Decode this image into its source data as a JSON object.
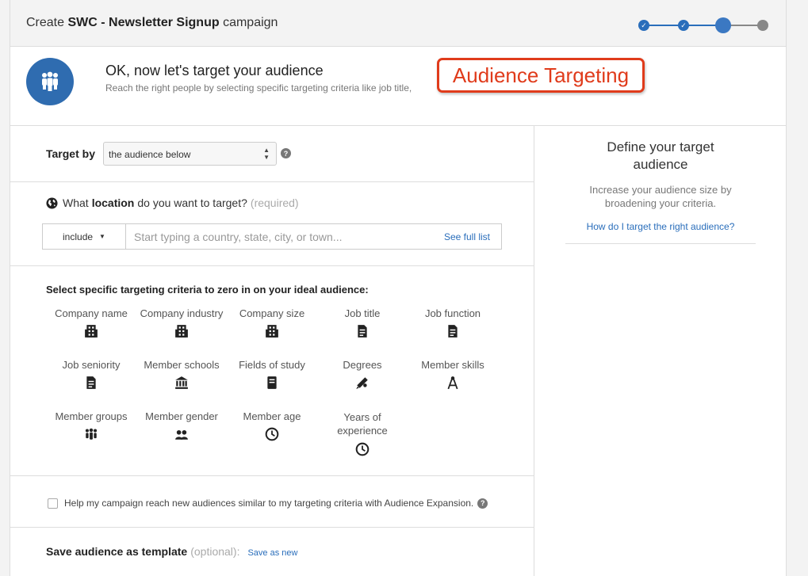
{
  "header": {
    "prefix": "Create",
    "campaign_name": "SWC - Newsletter Signup",
    "suffix": "campaign"
  },
  "stepper": {
    "total_steps": 4,
    "current_step": 3
  },
  "intro": {
    "title": "OK, now let's target your audience",
    "subtitle": "Reach the right people by selecting specific targeting criteria like job title,"
  },
  "callout": {
    "text": "Audience Targeting"
  },
  "target_by": {
    "label": "Target by",
    "selected": "the audience below",
    "help": "?"
  },
  "location": {
    "question_prefix": "What",
    "question_bold": "location",
    "question_suffix": "do you want to target?",
    "required": "(required)",
    "include_label": "include",
    "placeholder": "Start typing a country, state, city, or town...",
    "see_full_list": "See full list"
  },
  "criteria": {
    "title": "Select specific targeting criteria to zero in on your ideal audience:",
    "items": [
      {
        "label": "Company name",
        "icon": "building-icon"
      },
      {
        "label": "Company industry",
        "icon": "building-icon"
      },
      {
        "label": "Company size",
        "icon": "building-icon"
      },
      {
        "label": "Job title",
        "icon": "document-icon"
      },
      {
        "label": "Job function",
        "icon": "document-icon"
      },
      {
        "label": "Job seniority",
        "icon": "document-icon"
      },
      {
        "label": "Member schools",
        "icon": "institution-icon"
      },
      {
        "label": "Fields of study",
        "icon": "book-icon"
      },
      {
        "label": "Degrees",
        "icon": "diploma-icon"
      },
      {
        "label": "Member skills",
        "icon": "compass-icon"
      },
      {
        "label": "Member groups",
        "icon": "group-icon"
      },
      {
        "label": "Member gender",
        "icon": "people-icon"
      },
      {
        "label": "Member age",
        "icon": "clock-icon"
      },
      {
        "label": "Years of experience",
        "icon": "clock-icon"
      }
    ]
  },
  "expansion": {
    "label": "Help my campaign reach new audiences similar to my targeting criteria with Audience Expansion.",
    "checked": false,
    "help": "?"
  },
  "save": {
    "label": "Save audience as template",
    "optional": "(optional):",
    "link": "Save as new"
  },
  "sidebar": {
    "title": "Define your target audience",
    "subtitle": "Increase your audience size by broadening your criteria.",
    "link": "How do I target the right audience?"
  },
  "colors": {
    "brand_blue": "#2f6cb0",
    "link_blue": "#2a6ebb",
    "callout_red": "#e03b1b",
    "step_pending": "#888888"
  }
}
